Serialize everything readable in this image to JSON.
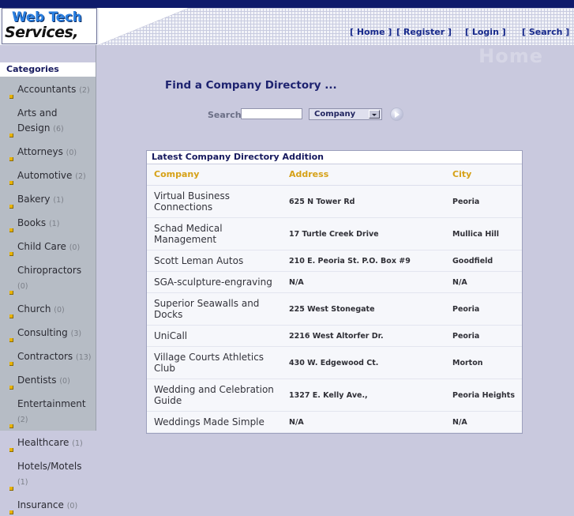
{
  "site": {
    "logo_line1": "Web Tech",
    "logo_line2": "Services, Inc.",
    "page_title": "Home"
  },
  "nav": {
    "items": [
      {
        "label": "[ Home ]"
      },
      {
        "label": "[ Register ]"
      },
      {
        "label": "[ Login ]"
      },
      {
        "label": "[ Search ]"
      }
    ]
  },
  "sidebar": {
    "heading": "Categories",
    "items": [
      {
        "label": "Accountants",
        "count": "(2)"
      },
      {
        "label": "Arts and Design",
        "count": "(6)"
      },
      {
        "label": "Attorneys",
        "count": "(0)"
      },
      {
        "label": "Automotive",
        "count": "(2)"
      },
      {
        "label": "Bakery",
        "count": "(1)"
      },
      {
        "label": "Books",
        "count": "(1)"
      },
      {
        "label": "Child Care",
        "count": "(0)"
      },
      {
        "label": "Chiropractors",
        "count": "(0)"
      },
      {
        "label": "Church",
        "count": "(0)"
      },
      {
        "label": "Consulting",
        "count": "(3)"
      },
      {
        "label": "Contractors",
        "count": "(13)"
      },
      {
        "label": "Dentists",
        "count": "(0)"
      },
      {
        "label": "Entertainment",
        "count": "(2)"
      },
      {
        "label": "Healthcare",
        "count": "(1)"
      },
      {
        "label": "Hotels/Motels",
        "count": "(1)"
      },
      {
        "label": "Insurance",
        "count": "(0)"
      }
    ]
  },
  "main": {
    "find_title": "Find a Company Directory ...",
    "search": {
      "label": "Search",
      "input_value": "",
      "input_placeholder": "",
      "select_value": "Company",
      "select_options": [
        "Company"
      ],
      "go_label": ""
    },
    "table": {
      "title": "Latest Company Directory Addition",
      "columns": [
        "Company",
        "Address",
        "City"
      ],
      "rows": [
        {
          "company": "Virtual Business Connections",
          "address": "625 N Tower Rd",
          "city": "Peoria"
        },
        {
          "company": "Schad Medical Management",
          "address": "17 Turtle Creek Drive",
          "city": "Mullica Hill"
        },
        {
          "company": "Scott Leman Autos",
          "address": "210 E. Peoria St. P.O. Box #9",
          "city": "Goodfield"
        },
        {
          "company": "SGA-sculpture-engraving",
          "address": "N/A",
          "city": "N/A"
        },
        {
          "company": "Superior Seawalls and Docks",
          "address": "225 West Stonegate",
          "city": "Peoria"
        },
        {
          "company": "UniCall",
          "address": "2216 West Altorfer Dr.",
          "city": "Peoria"
        },
        {
          "company": "Village Courts Athletics Club",
          "address": "430 W. Edgewood Ct.",
          "city": "Morton"
        },
        {
          "company": "Wedding and Celebration Guide",
          "address": "1327 E. Kelly Ave.,",
          "city": "Peoria Heights"
        },
        {
          "company": "Weddings Made Simple",
          "address": "N/A",
          "city": "N/A"
        }
      ]
    }
  },
  "colors": {
    "topbar": "#0e1a6b",
    "body_bg": "#c9c9de",
    "sidebar_bg": "#b6bcc5",
    "accent_heading": "#16195e",
    "column_header": "#d6a117",
    "bullet": "#e8b300"
  }
}
